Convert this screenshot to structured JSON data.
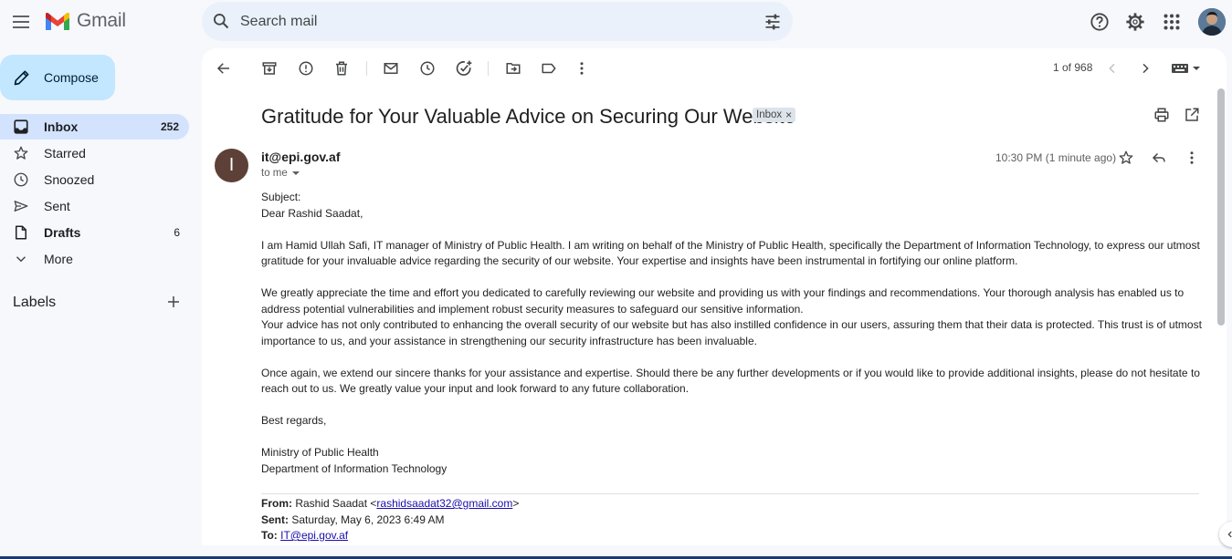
{
  "app": {
    "name": "Gmail"
  },
  "search": {
    "placeholder": "Search mail"
  },
  "compose": {
    "label": "Compose"
  },
  "sidebar": {
    "items": [
      {
        "label": "Inbox",
        "count": "252",
        "icon": "inbox-icon"
      },
      {
        "label": "Starred",
        "count": "",
        "icon": "star-icon"
      },
      {
        "label": "Snoozed",
        "count": "",
        "icon": "clock-icon"
      },
      {
        "label": "Sent",
        "count": "",
        "icon": "send-icon"
      },
      {
        "label": "Drafts",
        "count": "6",
        "icon": "draft-icon"
      },
      {
        "label": "More",
        "count": "",
        "icon": "chevron-down-icon"
      }
    ],
    "labels_heading": "Labels"
  },
  "toolbar": {
    "pager": "1 of 968"
  },
  "email": {
    "subject": "Gratitude for Your Valuable Advice on Securing Our Website",
    "chip": "Inbox",
    "chip_close": "×",
    "avatar_letter": "I",
    "sender": "it@epi.gov.af",
    "to": "to me",
    "time": "10:30 PM (1 minute ago)",
    "body": {
      "subject_line": "Subject:",
      "greeting": "Dear Rashid Saadat,",
      "p1": "I am Hamid Ullah Safi, IT manager of Ministry of Public Health. I am writing on behalf of the Ministry of Public Health, specifically the Department of Information Technology, to express our utmost gratitude for your invaluable advice regarding the security of our website. Your expertise and insights have been instrumental in fortifying our online platform.",
      "p2": "We greatly appreciate the time and effort you dedicated to carefully reviewing our website and providing us with your findings and recommendations. Your thorough analysis has enabled us to address potential vulnerabilities and implement robust security measures to safeguard our sensitive information.",
      "p3": "Your advice has not only contributed to enhancing the overall security of our website but has also instilled confidence in our users, assuring them that their data is protected. This trust is of utmost importance to us, and your assistance in strengthening our security infrastructure has been invaluable.",
      "p4": "Once again, we extend our sincere thanks for your assistance and expertise. Should there be any further developments or if you would like to provide additional insights, please do not hesitate to reach out to us. We greatly value your input and look forward to any future collaboration.",
      "closing": "Best regards,",
      "sig1": "Ministry of Public Health",
      "sig2": "Department of Information Technology"
    },
    "forward": {
      "from_label": "From:",
      "from_name": "Rashid Saadat <",
      "from_email": "rashidsaadat32@gmail.com",
      "from_end": ">",
      "sent_label": "Sent:",
      "sent_value": "Saturday, May 6, 2023 6:49 AM",
      "to_label": "To:",
      "to_email": "IT@epi.gov.af"
    }
  },
  "colors": {
    "accent": "#c2e7ff",
    "active_nav": "#d3e3fd",
    "search_bg": "#eaf1fb",
    "avatar_bg": "#5d4037"
  }
}
